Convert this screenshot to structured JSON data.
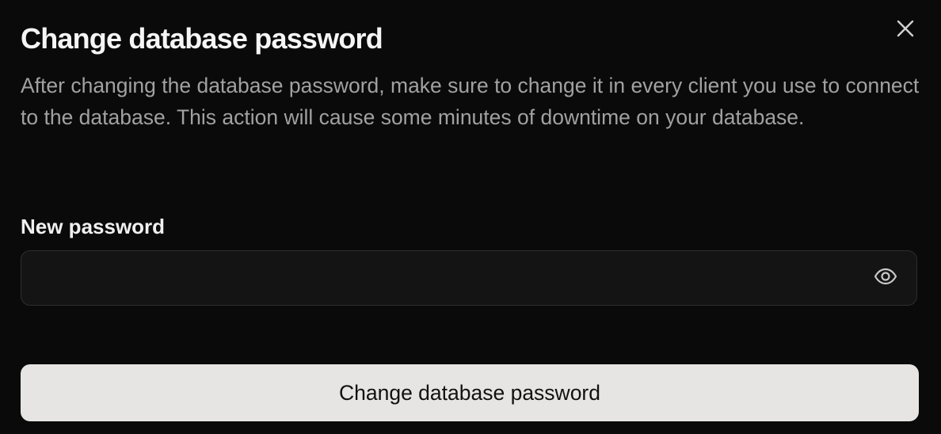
{
  "dialog": {
    "title": "Change database password",
    "description": "After changing the database password, make sure to change it in every client you use to connect to the database. This action will cause some minutes of downtime on your database.",
    "close_icon": "close-icon",
    "password_field": {
      "label": "New password",
      "value": "",
      "placeholder": "",
      "toggle_icon": "eye-icon"
    },
    "submit_label": "Change database password"
  },
  "colors": {
    "background": "#0a0a0a",
    "title_text": "#f5f5f5",
    "muted_text": "#a1a1a1",
    "input_background": "#141414",
    "input_border": "#2e2e2e",
    "button_background": "#e6e5e3",
    "button_text": "#111111"
  }
}
